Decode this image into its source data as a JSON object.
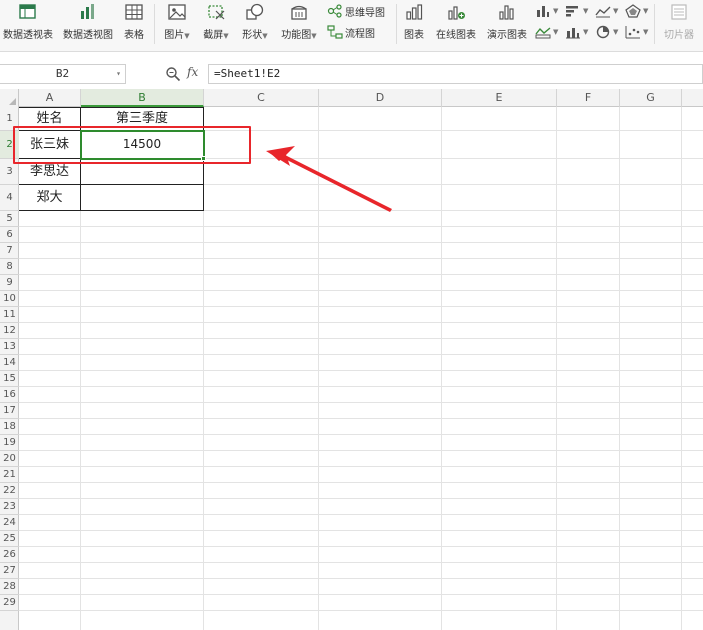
{
  "ribbon": {
    "buttons": [
      {
        "id": "pivot-table",
        "label": "数据透视表",
        "icon": "pivot-table-icon"
      },
      {
        "id": "pivot-chart",
        "label": "数据透视图",
        "icon": "pivot-chart-icon"
      },
      {
        "id": "table",
        "label": "表格",
        "icon": "table-icon"
      },
      {
        "id": "picture",
        "label": "图片",
        "icon": "picture-icon"
      },
      {
        "id": "screenshot",
        "label": "截屏",
        "icon": "screenshot-icon"
      },
      {
        "id": "shapes",
        "label": "形状",
        "icon": "shapes-icon"
      },
      {
        "id": "function-diagram",
        "label": "功能图",
        "icon": "function-diagram-icon"
      },
      {
        "id": "chart",
        "label": "图表",
        "icon": "chart-icon"
      },
      {
        "id": "online-chart",
        "label": "在线图表",
        "icon": "online-chart-icon"
      },
      {
        "id": "demo-chart",
        "label": "演示图表",
        "icon": "demo-chart-icon"
      },
      {
        "id": "slicer",
        "label": "切片器",
        "icon": "slicer-icon",
        "disabled": true
      }
    ],
    "small": {
      "mindmap": "思维导图",
      "flowchart": "流程图"
    }
  },
  "formula_bar": {
    "name_box": "B2",
    "fx_label": "fx",
    "formula": "=Sheet1!E2"
  },
  "columns": [
    "A",
    "B",
    "C",
    "D",
    "E",
    "F",
    "G"
  ],
  "active_column": "B",
  "rows": [
    "1",
    "2",
    "3",
    "4",
    "5",
    "6",
    "7",
    "8",
    "9",
    "10",
    "11",
    "12",
    "13",
    "14",
    "15",
    "16",
    "17",
    "18",
    "19",
    "20",
    "21",
    "22",
    "23",
    "24",
    "25",
    "26",
    "27",
    "28",
    "29"
  ],
  "active_row": "2",
  "table": {
    "header_a": "姓名",
    "header_b": "第三季度",
    "rows": [
      {
        "name": "张三妹",
        "value": "14500"
      },
      {
        "name": "李思达",
        "value": ""
      },
      {
        "name": "郑大",
        "value": ""
      }
    ]
  },
  "colors": {
    "selection": "#2e8b2e",
    "highlight_box": "#e8262b",
    "arrow": "#e8262b"
  }
}
